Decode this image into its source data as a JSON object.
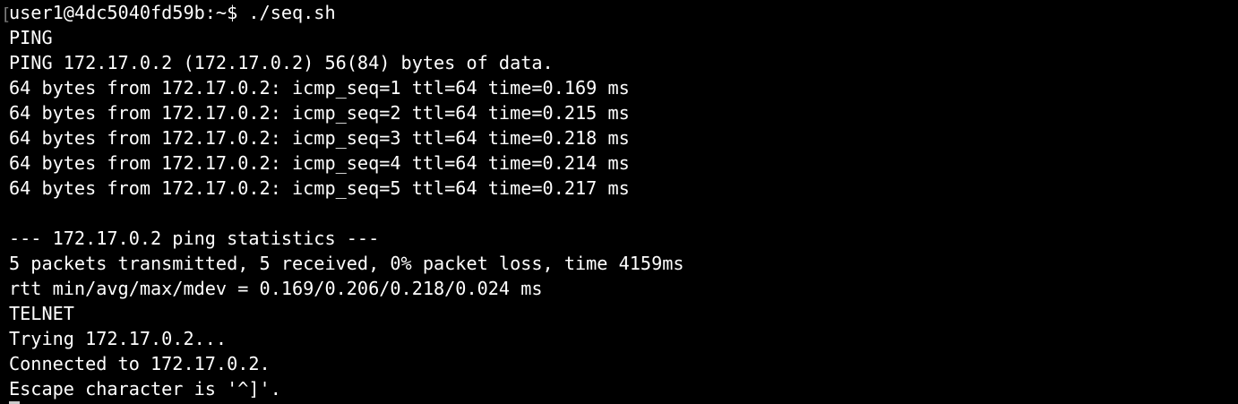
{
  "terminal": {
    "bracket": "[",
    "prompt": "user1@4dc5040fd59b:~$ ./seq.sh",
    "lines": [
      "PING",
      "PING 172.17.0.2 (172.17.0.2) 56(84) bytes of data.",
      "64 bytes from 172.17.0.2: icmp_seq=1 ttl=64 time=0.169 ms",
      "64 bytes from 172.17.0.2: icmp_seq=2 ttl=64 time=0.215 ms",
      "64 bytes from 172.17.0.2: icmp_seq=3 ttl=64 time=0.218 ms",
      "64 bytes from 172.17.0.2: icmp_seq=4 ttl=64 time=0.214 ms",
      "64 bytes from 172.17.0.2: icmp_seq=5 ttl=64 time=0.217 ms",
      "",
      "--- 172.17.0.2 ping statistics ---",
      "5 packets transmitted, 5 received, 0% packet loss, time 4159ms",
      "rtt min/avg/max/mdev = 0.169/0.206/0.218/0.024 ms",
      "TELNET",
      "Trying 172.17.0.2...",
      "Connected to 172.17.0.2.",
      "Escape character is '^]'."
    ]
  }
}
